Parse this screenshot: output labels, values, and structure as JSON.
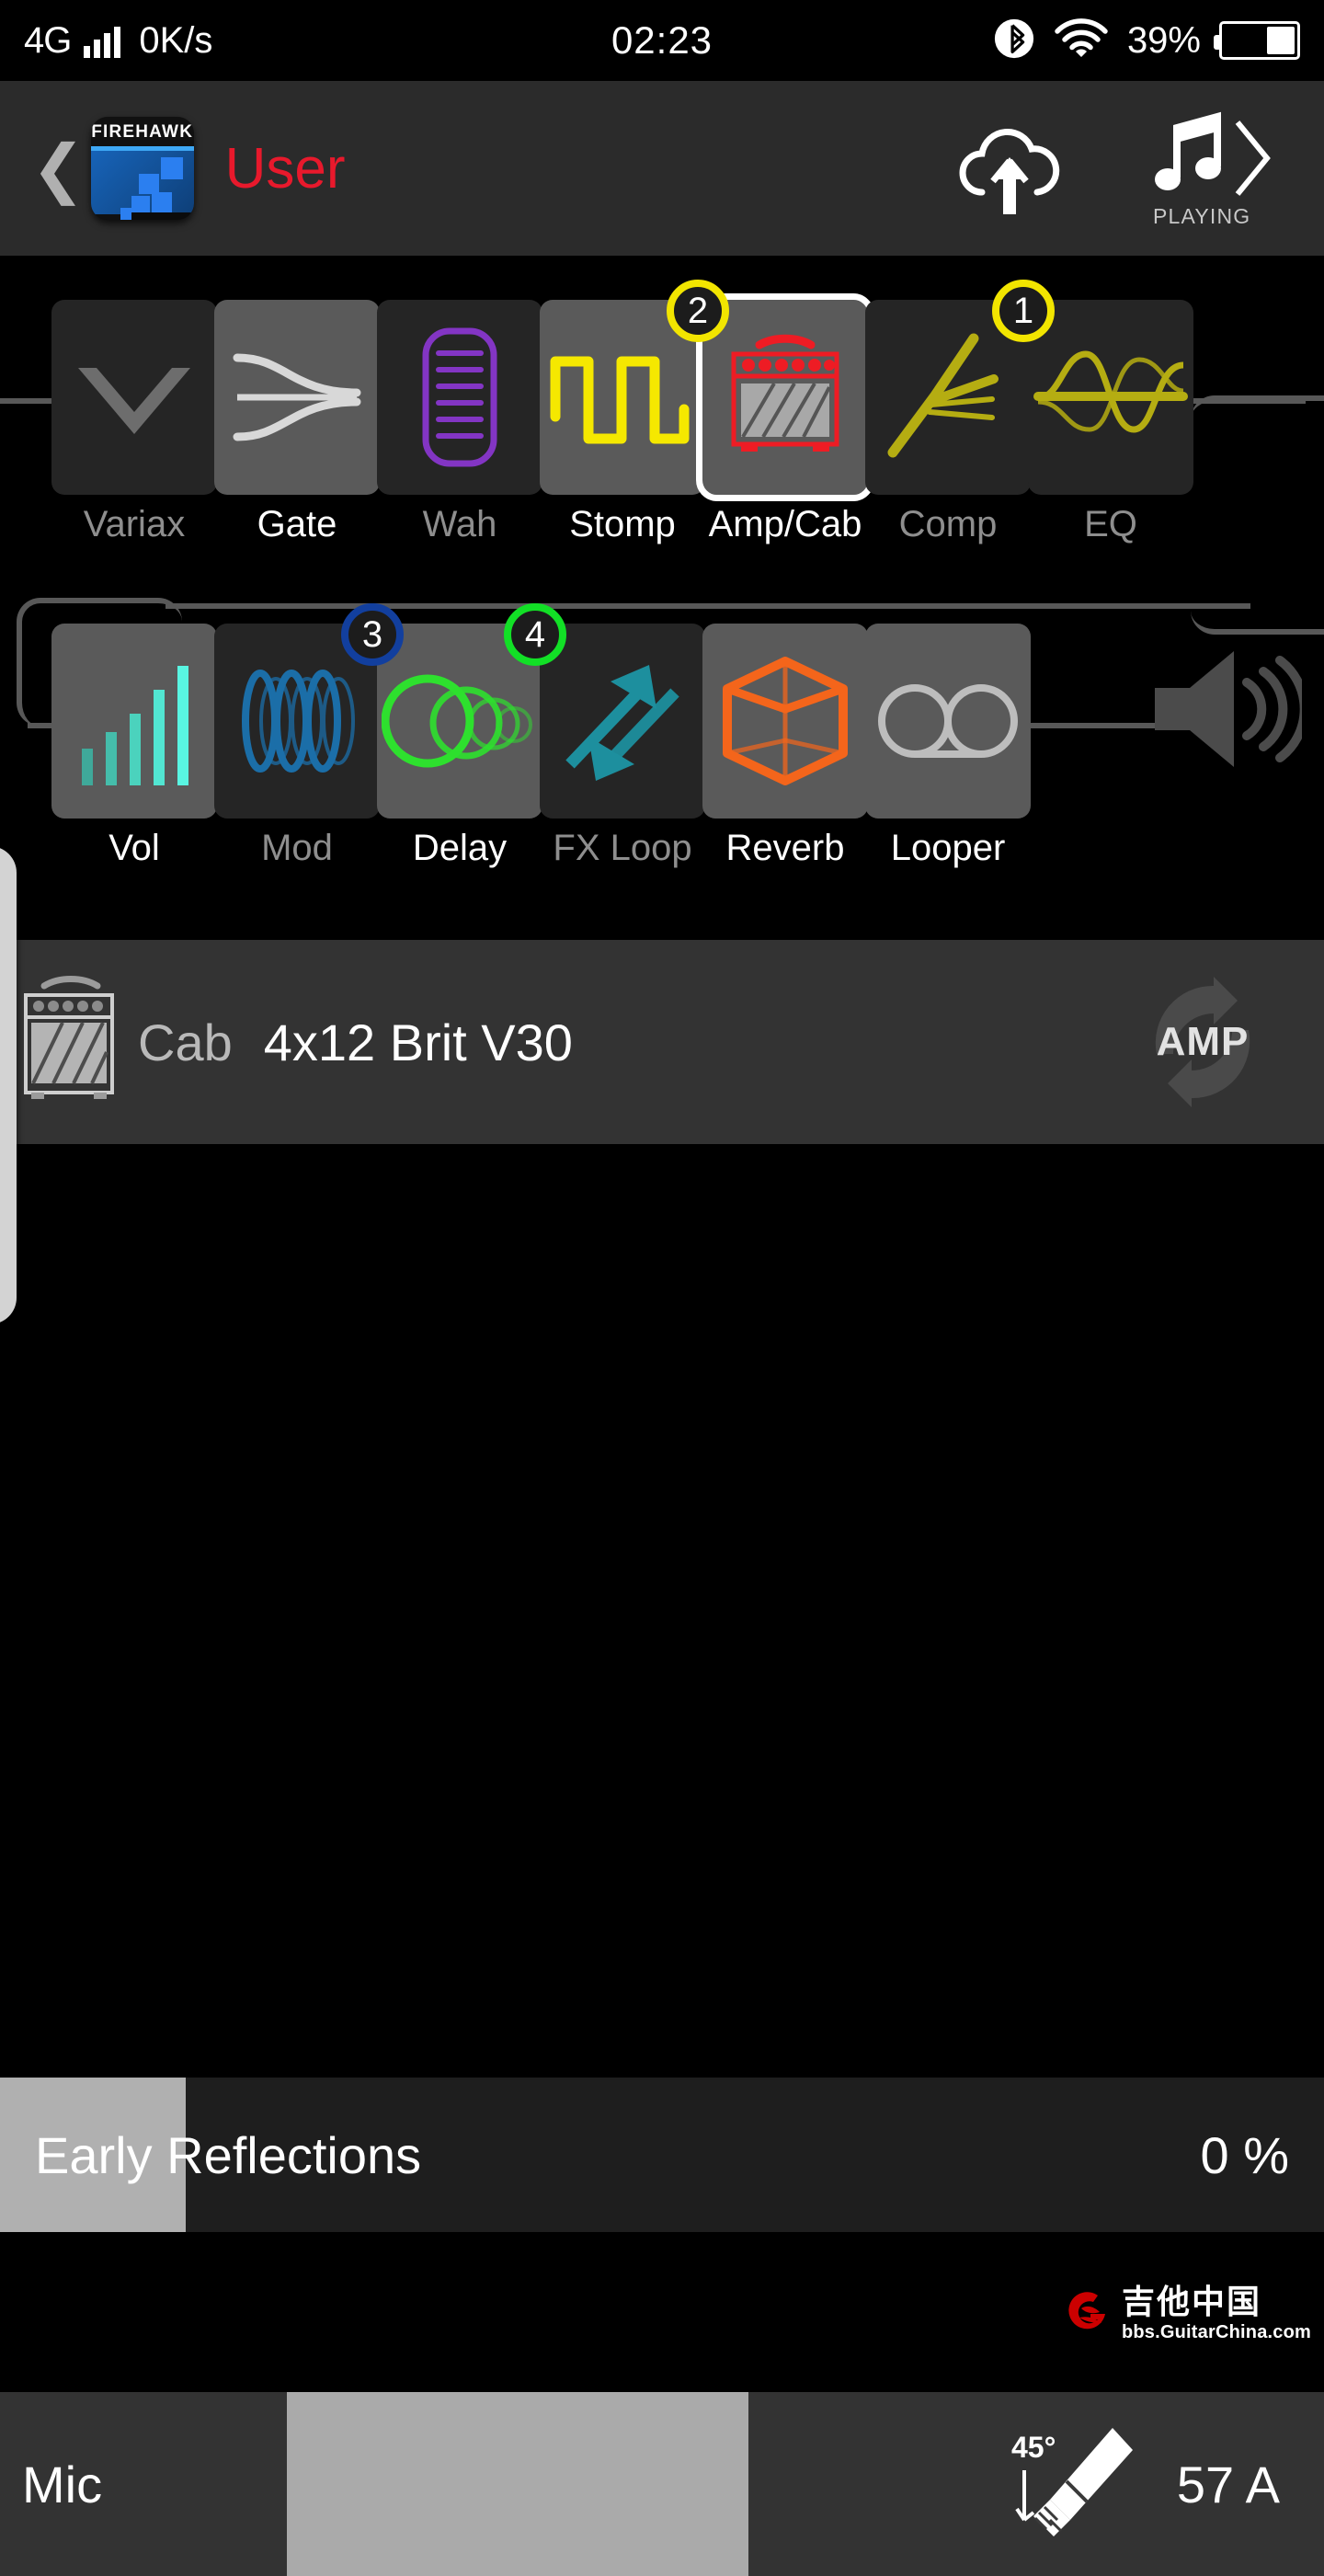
{
  "status_bar": {
    "network": "4G",
    "speed": "0K/s",
    "clock": "02:23",
    "battery_pct": "39%",
    "bluetooth_icon": "bluetooth-icon",
    "wifi_icon": "wifi-icon",
    "battery_icon": "battery-icon",
    "signal_icon": "signal-bars-icon",
    "battery_level": 39
  },
  "header": {
    "back_icon": "back-chevron-icon",
    "app_icon_title": "FIREHAWK",
    "title": "User",
    "title_color": "#e8192c",
    "cloud_icon": "cloud-upload-icon",
    "music_icon": "music-note-icon",
    "next_icon": "chevron-right-icon",
    "playing_label": "PLAYING"
  },
  "chain": {
    "top_row": [
      {
        "label": "Variax",
        "state": "off",
        "icon": "variax-v-icon",
        "badge": null,
        "selected": false,
        "accent": "#6d6d6d"
      },
      {
        "label": "Gate",
        "state": "on",
        "icon": "gate-icon",
        "badge": null,
        "selected": false,
        "accent": "#d8d8d8"
      },
      {
        "label": "Wah",
        "state": "off",
        "icon": "wah-pedal-icon",
        "badge": null,
        "selected": false,
        "accent": "#8335c4"
      },
      {
        "label": "Stomp",
        "state": "on",
        "icon": "stomp-square-wave-icon",
        "badge": "2",
        "badge_color": "#f2e500",
        "selected": false,
        "accent": "#f5e800"
      },
      {
        "label": "Amp/Cab",
        "state": "on",
        "icon": "amp-cab-icon",
        "badge": null,
        "selected": true,
        "accent": "#ee1c24"
      },
      {
        "label": "Comp",
        "state": "off",
        "icon": "comp-curve-icon",
        "badge": "1",
        "badge_color": "#b5ad12",
        "selected": false,
        "accent": "#b5ad12"
      },
      {
        "label": "EQ",
        "state": "off",
        "icon": "eq-curve-icon",
        "badge": null,
        "selected": false,
        "accent": "#b5ad12"
      }
    ],
    "bottom_row": [
      {
        "label": "Vol",
        "state": "on",
        "icon": "volume-bars-icon",
        "badge": null,
        "selected": false,
        "accent": "#4ee8d8"
      },
      {
        "label": "Mod",
        "state": "off",
        "icon": "mod-sine-icon",
        "badge": "3",
        "badge_color": "#123f9e",
        "selected": false,
        "accent": "#1b6ea8"
      },
      {
        "label": "Delay",
        "state": "on",
        "icon": "delay-circles-icon",
        "badge": "4",
        "badge_color": "#12e026",
        "selected": false,
        "accent": "#2ee02e"
      },
      {
        "label": "FX Loop",
        "state": "off",
        "icon": "fx-loop-arrows-icon",
        "badge": null,
        "selected": false,
        "accent": "#1d8f9e"
      },
      {
        "label": "Reverb",
        "state": "on",
        "icon": "reverb-cube-icon",
        "badge": null,
        "selected": false,
        "accent": "#f4651b"
      },
      {
        "label": "Looper",
        "state": "on",
        "icon": "looper-reels-icon",
        "badge": null,
        "selected": false,
        "accent": "#bdbdbd"
      }
    ],
    "output_icon": "speaker-output-icon"
  },
  "params": {
    "cab": {
      "icon": "amp-cab-small-icon",
      "type_label": "Cab",
      "value": "4x12 Brit V30",
      "toggle_icon": "amp-cab-swap-icon",
      "toggle_label": "AMP"
    },
    "early_reflections": {
      "label": "Early Reflections",
      "value": "0 %",
      "fill_percent": 14
    },
    "mic": {
      "label": "Mic",
      "value": "57 A",
      "icon": "microphone-45deg-icon",
      "icon_angle_label": "45°",
      "fill_start_percent": 21.7,
      "fill_end_percent": 56.5
    }
  },
  "watermark": {
    "logo_icon": "guitarchina-logo-icon",
    "name": "吉他中国",
    "url": "bbs.GuitarChina.com"
  }
}
